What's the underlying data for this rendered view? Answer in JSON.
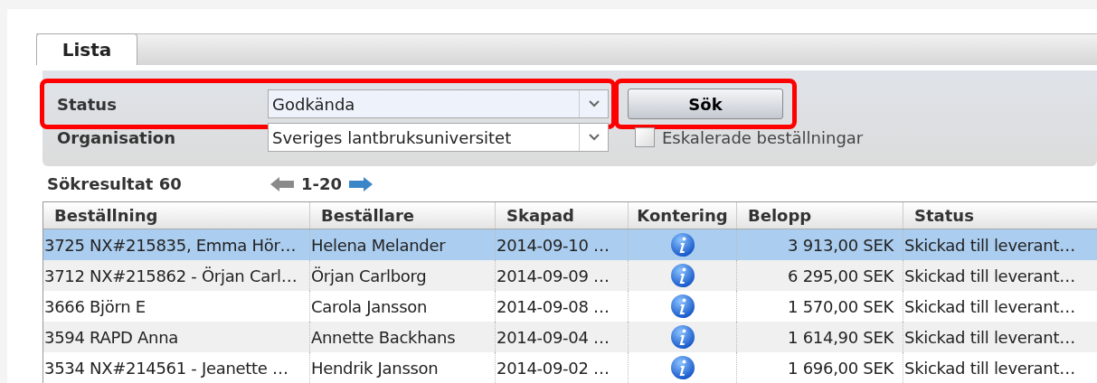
{
  "tabs": [
    {
      "label": "Lista",
      "selected": true
    }
  ],
  "filters": {
    "status": {
      "label": "Status",
      "value": "Godkända",
      "highlighted": true
    },
    "organisation": {
      "label": "Organisation",
      "value": "Sveriges lantbruksuniversitet",
      "highlighted": false
    },
    "search_button": {
      "label": "Sök",
      "highlighted": true
    },
    "escalated": {
      "label": "Eskalerade beställningar",
      "checked": false
    }
  },
  "results": {
    "label": "Sökresultat 60",
    "range": "1-20"
  },
  "table": {
    "columns": [
      "Beställning",
      "Beställare",
      "Skapad",
      "Kontering",
      "Belopp",
      "Status"
    ],
    "rows": [
      {
        "order": "3725 NX#215835, Emma Hör…",
        "orderer": "Helena Melander",
        "created": "2014-09-10 …",
        "amount": "3 913,00 SEK",
        "status": "Skickad till leverant…",
        "selected": true
      },
      {
        "order": "3712 NX#215862 - Örjan Carl…",
        "orderer": "Örjan Carlborg",
        "created": "2014-09-09 …",
        "amount": "6 295,00 SEK",
        "status": "Skickad till leverant…",
        "selected": false
      },
      {
        "order": "3666 Björn E",
        "orderer": "Carola Jansson",
        "created": "2014-09-08 …",
        "amount": "1 570,00 SEK",
        "status": "Skickad till leverant…",
        "selected": false
      },
      {
        "order": "3594 RAPD Anna",
        "orderer": "Annette Backhans",
        "created": "2014-09-04 …",
        "amount": "1 614,90 SEK",
        "status": "Skickad till leverant…",
        "selected": false
      },
      {
        "order": "3534 NX#214561 - Jeanette …",
        "orderer": "Hendrik Jansson",
        "created": "2014-09-02 …",
        "amount": "1 696,00 SEK",
        "status": "Skickad till leverant…",
        "selected": false
      }
    ]
  }
}
